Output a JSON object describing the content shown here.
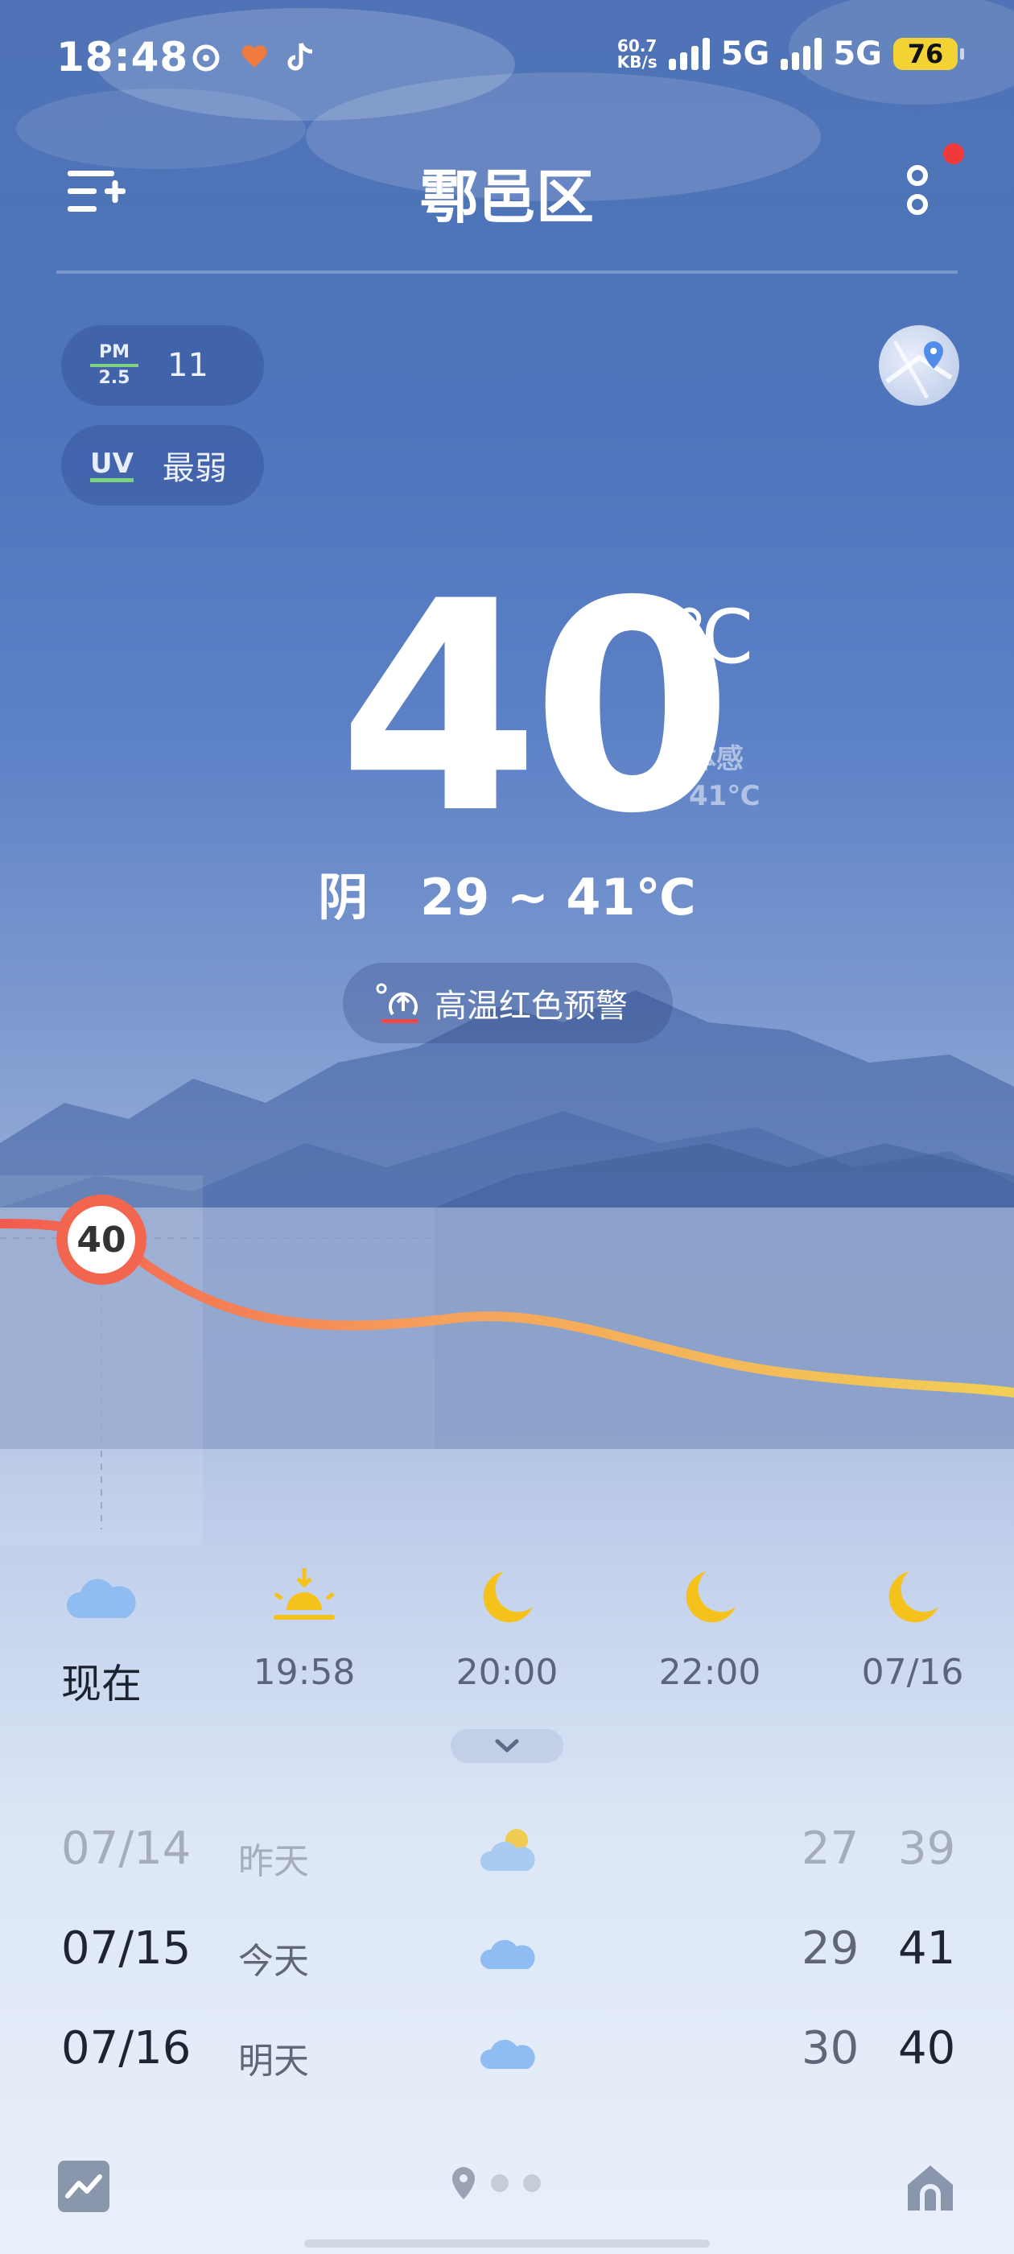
{
  "status_bar": {
    "time": "18:48",
    "net_speed_value": "60.7",
    "net_speed_unit": "KB/s",
    "network_1": "5G",
    "network_2": "5G",
    "battery": "76"
  },
  "header": {
    "city": "鄠邑区"
  },
  "air": {
    "pm_label_top": "PM",
    "pm_label_bottom": "2.5",
    "pm_value": "11",
    "uv_label": "UV",
    "uv_value": "最弱"
  },
  "current": {
    "temperature": "40",
    "unit": "℃",
    "feels_label": "体感",
    "feels_value": "41℃",
    "condition_range": "阴   29 ~ 41℃",
    "alert": "高温红色预警",
    "badge_temp": "40"
  },
  "hourly": [
    {
      "label": "现在",
      "icon": "cloud-icon"
    },
    {
      "label": "19:58",
      "icon": "sunset-icon"
    },
    {
      "label": "20:00",
      "icon": "moon-icon"
    },
    {
      "label": "22:00",
      "icon": "moon-icon"
    },
    {
      "label": "07/16",
      "icon": "moon-icon"
    }
  ],
  "daily": [
    {
      "date": "07/14",
      "name": "昨天",
      "icon": "partly-cloudy-icon",
      "low": "27",
      "high": "39"
    },
    {
      "date": "07/15",
      "name": "今天",
      "icon": "cloud-icon",
      "low": "29",
      "high": "41"
    },
    {
      "date": "07/16",
      "name": "明天",
      "icon": "cloud-icon",
      "low": "30",
      "high": "40"
    }
  ],
  "colors": {
    "accent_red": "#f26650",
    "trend_orange": "#f6a35c",
    "trend_yellow": "#f1cf56",
    "sun_yellow": "#f5c21b",
    "cloud_blue": "#8fbdf2"
  }
}
